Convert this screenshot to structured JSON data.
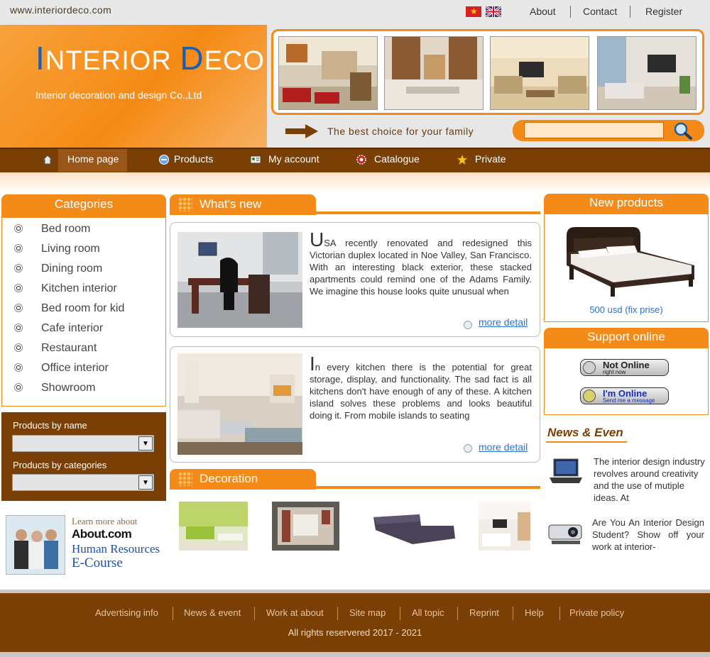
{
  "top": {
    "url": "www.interiordeco.com",
    "links": [
      "About",
      "Contact",
      "Register"
    ]
  },
  "header": {
    "logo_first_initial": "I",
    "logo_first_rest": "NTERIOR",
    "logo_second_initial": "D",
    "logo_second_rest": "ECO",
    "company": "Interior decoration and design Co.,Ltd",
    "slogan": "The best choice for your family",
    "search_value": ""
  },
  "nav": {
    "items": [
      {
        "label": "Home page",
        "icon": "home-icon"
      },
      {
        "label": "Products",
        "icon": "products-icon"
      },
      {
        "label": "My account",
        "icon": "account-icon"
      },
      {
        "label": "Catalogue",
        "icon": "catalogue-icon"
      },
      {
        "label": "Private",
        "icon": "star-icon"
      }
    ]
  },
  "categories": {
    "title": "Categories",
    "items": [
      "Bed room",
      "Living room",
      "Dining room",
      "Kitchen interior",
      "Bed room for kid",
      "Cafe interior",
      "Restaurant",
      "Office interior",
      "Showroom"
    ]
  },
  "product_search": {
    "by_name_label": "Products by name",
    "by_category_label": "Products by categories"
  },
  "ad": {
    "line1": "Learn more about",
    "brand": "About.com",
    "line3": "Human Resources",
    "line4": "E-Course"
  },
  "whats_new": {
    "title": "What's new",
    "articles": [
      {
        "initial": "U",
        "text": "SA recently renovated and redesigned this Victorian duplex located in Noe Valley, San Francisco. With an interesting black exterior, these stacked apartments could remind one of the Adams Family. We imagine this house looks quite unusual when",
        "more": "more detail"
      },
      {
        "initial": "I",
        "text": "n every kitchen there is the potential for great storage, display, and functionality. The sad fact is all kitchens don't have enough of any of these. A kitchen island solves these problems and looks beautiful doing it.  From mobile islands to seating",
        "more": "more detail"
      }
    ]
  },
  "decoration": {
    "title": "Decoration"
  },
  "new_products": {
    "title": "New products",
    "price": "500 usd (fix prise)"
  },
  "support": {
    "title": "Support online",
    "agents": [
      {
        "status": "Not Online",
        "sub": "right now"
      },
      {
        "status": "I'm Online",
        "sub": "Send me a message"
      }
    ]
  },
  "news": {
    "title": "News & Even",
    "items": [
      "The interior design industry revolves around creativity and the use of mutiple ideas. At",
      "Are You An Interior Design Student? Show off your work at interior-"
    ]
  },
  "footer": {
    "links": [
      "Advertising info",
      "News & event",
      "Work at about",
      "Site map",
      "All topic",
      "Reprint",
      "Help",
      "Private policy"
    ],
    "copyright": "All rights reservered 2017 - 2021"
  },
  "colors": {
    "orange": "#f48a18",
    "brown": "#7a3f04",
    "link_blue": "#2d71c9"
  }
}
